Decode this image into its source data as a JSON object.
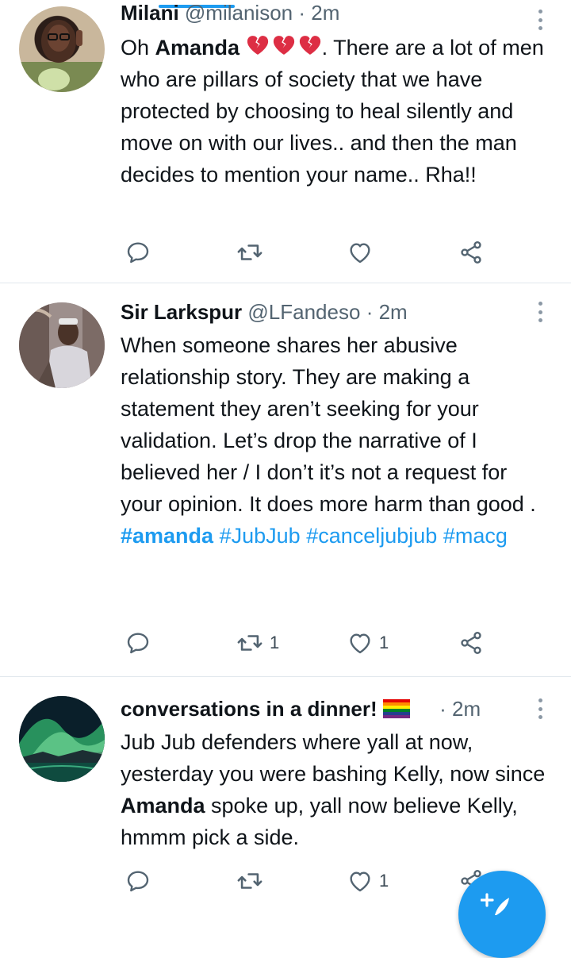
{
  "tweets": [
    {
      "name": "Milani",
      "handle": "@milanison",
      "sep": "·",
      "time": "2m",
      "text_before": "Oh ",
      "text_bold": "Amanda",
      "text_after": ". There are a lot of men who are pillars of society that we have protected by choosing to heal silently and move on with our lives.. and then the man decides to mention your name.. Rha!!",
      "reply_count": "",
      "retweet_count": "",
      "like_count": ""
    },
    {
      "name": "Sir Larkspur",
      "handle": "@LFandeso",
      "sep": "·",
      "time": "2m",
      "text": "When someone shares her abusive relationship story. They are making a statement they aren’t seeking for your validation. Let’s drop the narrative of I believed her / I don’t it’s not a request for your opinion. It does more harm than good .",
      "hashtags": [
        "#amanda",
        "#JubJub",
        "#canceljubjub",
        "#macg"
      ],
      "reply_count": "",
      "retweet_count": "1",
      "like_count": "1"
    },
    {
      "name": "conversations in a dinner!",
      "handle": "",
      "sep": "·",
      "time": "2m",
      "text_before": "Jub Jub defenders where yall at now, yesterday you were bashing Kelly, now since ",
      "text_bold": "Amanda",
      "text_after": " spoke up, yall now believe Kelly, hmmm pick a side.",
      "reply_count": "",
      "retweet_count": "",
      "like_count": "1"
    }
  ],
  "icons": {
    "reply": "reply-icon",
    "retweet": "retweet-icon",
    "like": "heart-icon",
    "share": "share-icon",
    "more": "more-vertical-icon",
    "broken_heart": "broken-heart-emoji",
    "rainbow_flag": "rainbow-flag-emoji",
    "compose": "compose-tweet-icon"
  },
  "colors": {
    "accent": "#1d9bf0",
    "text": "#0f1419",
    "muted": "#536471",
    "broken_heart": "#dd2e44",
    "divider": "#e1e8ed"
  }
}
